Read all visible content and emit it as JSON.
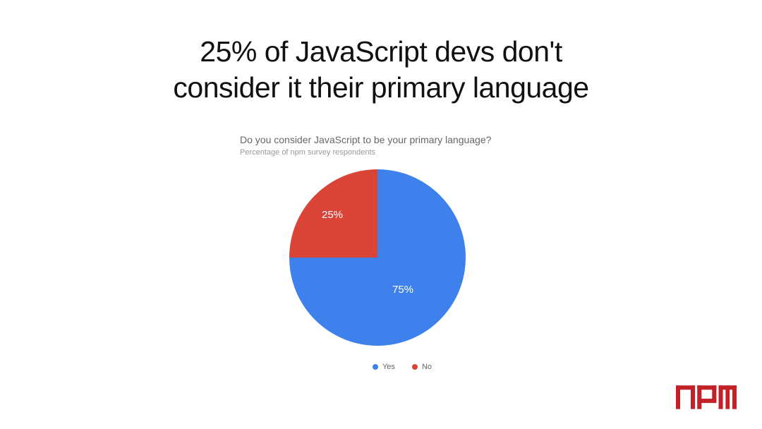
{
  "headline_line1": "25% of JavaScript devs don't",
  "headline_line2": "consider it their primary language",
  "chart_data": {
    "type": "pie",
    "title": "Do you consider JavaScript to be your primary language?",
    "subtitle": "Percentage of npm survey respondents",
    "series": [
      {
        "name": "Yes",
        "value": 75,
        "label": "75%",
        "color": "#3f81ec"
      },
      {
        "name": "No",
        "value": 25,
        "label": "25%",
        "color": "#d94436"
      }
    ]
  },
  "logo": {
    "name": "npm",
    "color": "#c12127"
  }
}
